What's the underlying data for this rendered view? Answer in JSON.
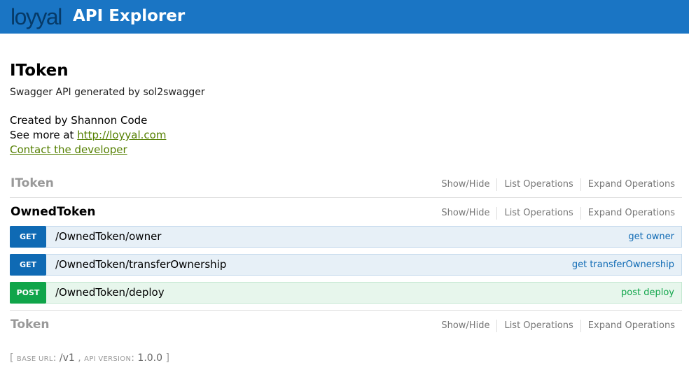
{
  "header": {
    "logo_text": "loyyal",
    "title": "API Explorer",
    "brand_color": "#1a75c4"
  },
  "info": {
    "title": "IToken",
    "description": "Swagger API generated by sol2swagger",
    "created_by": "Created by Shannon Code",
    "see_more_prefix": "See more at ",
    "see_more_link": "http://loyyal.com",
    "contact_link": "Contact the developer"
  },
  "resources": [
    {
      "name": "IToken",
      "actions": {
        "show_hide": "Show/Hide",
        "list": "List Operations",
        "expand": "Expand Operations"
      }
    },
    {
      "name": "OwnedToken",
      "actions": {
        "show_hide": "Show/Hide",
        "list": "List Operations",
        "expand": "Expand Operations"
      },
      "operations": [
        {
          "method": "GET",
          "path": "/OwnedToken/owner",
          "summary": "get owner"
        },
        {
          "method": "GET",
          "path": "/OwnedToken/transferOwnership",
          "summary": "get transferOwnership"
        },
        {
          "method": "POST",
          "path": "/OwnedToken/deploy",
          "summary": "post deploy"
        }
      ]
    },
    {
      "name": "Token",
      "actions": {
        "show_hide": "Show/Hide",
        "list": "List Operations",
        "expand": "Expand Operations"
      }
    }
  ],
  "footer": {
    "open_bracket": "[",
    "base_url_label": "base url",
    "base_url_value": "/v1",
    "api_version_label": "api version",
    "api_version_value": "1.0.0",
    "close_bracket": "]"
  },
  "colors": {
    "get": "#0f6ab4",
    "post": "#10a54a",
    "link": "#547f00"
  }
}
